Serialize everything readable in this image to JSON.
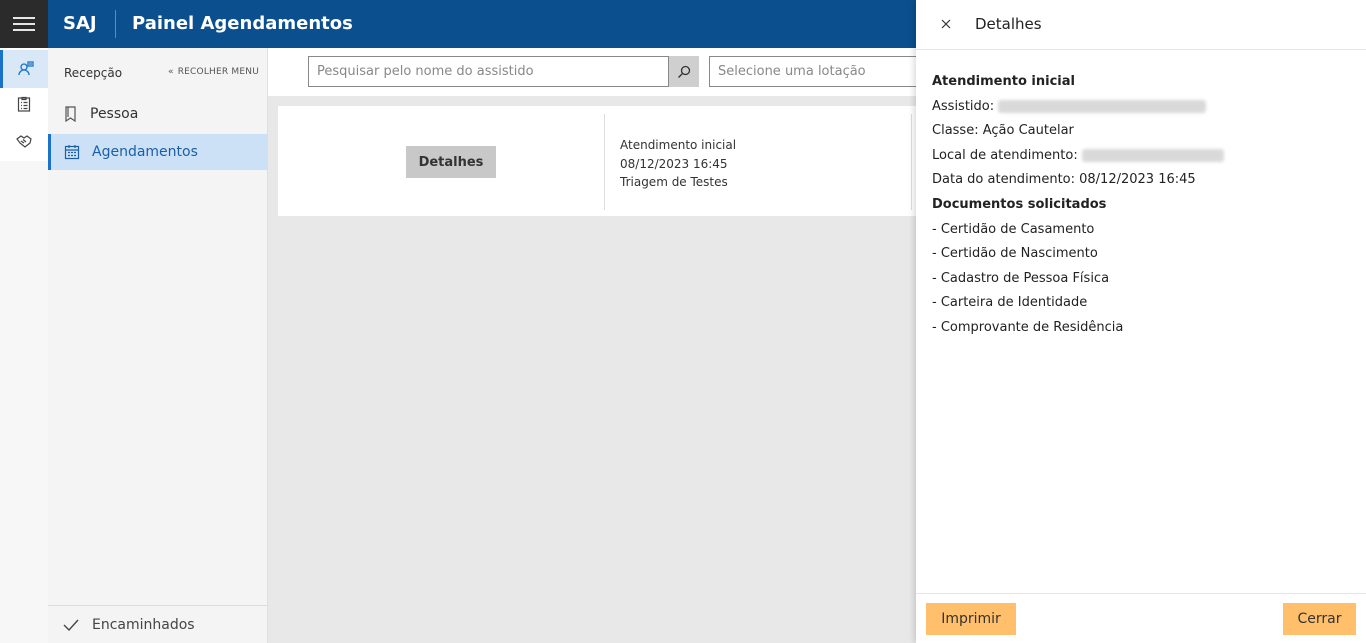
{
  "header": {
    "brand": "SAJ",
    "title": "Painel Agendamentos"
  },
  "sidebar": {
    "heading": "Recepção",
    "collapse_label": "RECOLHER MENU",
    "items": [
      {
        "label": "Pessoa",
        "icon": "bookmark-icon"
      },
      {
        "label": "Agendamentos",
        "icon": "calendar-icon"
      }
    ],
    "footer_label": "Encaminhados"
  },
  "filters": {
    "search_placeholder": "Pesquisar pelo nome do assistido",
    "lotacao_placeholder": "Selecione uma lotação"
  },
  "card": {
    "button_label": "Detalhes",
    "line1": "Atendimento inicial",
    "line2": "08/12/2023 16:45",
    "line3": "Triagem de Testes"
  },
  "panel": {
    "title": "Detalhes",
    "section1": "Atendimento inicial",
    "assistido_label": "Assistido:",
    "classe": "Classe: Ação Cautelar",
    "local_label": "Local de atendimento:",
    "data": "Data do atendimento: 08/12/2023 16:45",
    "section2": "Documentos solicitados",
    "documents": [
      "- Certidão de Casamento",
      "- Certidão de Nascimento",
      "- Cadastro de Pessoa Física",
      "- Carteira de Identidade",
      "- Comprovante de Residência"
    ],
    "print_label": "Imprimir",
    "close_label": "Cerrar"
  },
  "colors": {
    "header_bg": "#0c4f8f",
    "accent": "#1a73c9",
    "button_orange": "#ffbf6b"
  }
}
